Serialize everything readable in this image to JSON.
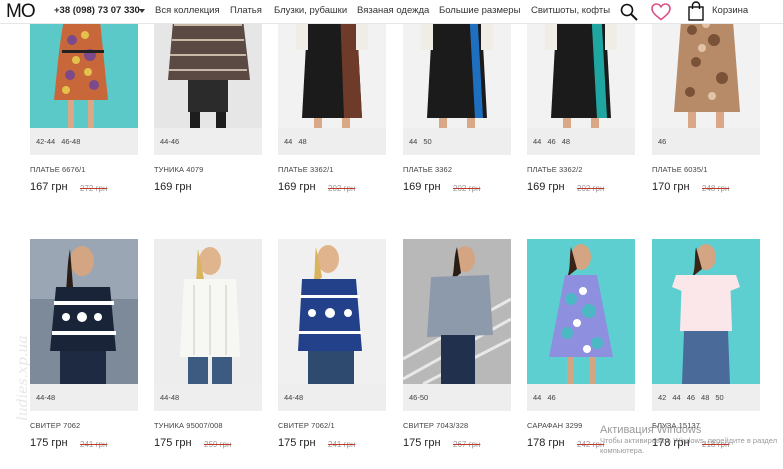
{
  "header": {
    "logo": "MO",
    "phone": "+38 (098) 73 07 330",
    "nav": [
      "Вся коллекция",
      "Платья",
      "Блузки, рубашки",
      "Вязаная одежда",
      "Большие размеры",
      "Свитшоты, кофты"
    ],
    "cart_label": "Корзина",
    "icons": {
      "search": "search-icon",
      "wishlist": "heart-icon",
      "cart": "shopping-bag-icon"
    },
    "colors": {
      "heart": "#d94f86"
    }
  },
  "products": [
    {
      "sizes": [
        "42-44",
        "46-48"
      ],
      "name": "ПЛАТЬЕ 6676/1",
      "price": "167 грн",
      "old_price": "272 грн"
    },
    {
      "sizes": [
        "44-46"
      ],
      "name": "ТУНИКА 4079",
      "price": "169 грн",
      "old_price": ""
    },
    {
      "sizes": [
        "44",
        "48"
      ],
      "name": "ПЛАТЬЕ 3362/1",
      "price": "169 грн",
      "old_price": "202 грн"
    },
    {
      "sizes": [
        "44",
        "50"
      ],
      "name": "ПЛАТЬЕ 3362",
      "price": "169 грн",
      "old_price": "202 грн"
    },
    {
      "sizes": [
        "44",
        "46",
        "48"
      ],
      "name": "ПЛАТЬЕ 3362/2",
      "price": "169 грн",
      "old_price": "202 грн"
    },
    {
      "sizes": [
        "46"
      ],
      "name": "ПЛАТЬЕ 6035/1",
      "price": "170 грн",
      "old_price": "248 грн"
    },
    {
      "sizes": [
        "44-48"
      ],
      "name": "СВИТЕР 7062",
      "price": "175 грн",
      "old_price": "241 грн"
    },
    {
      "sizes": [
        "44-48"
      ],
      "name": "ТУНИКА 95007/008",
      "price": "175 грн",
      "old_price": "259 грн"
    },
    {
      "sizes": [
        "44-48"
      ],
      "name": "СВИТЕР 7062/1",
      "price": "175 грн",
      "old_price": "241 грн"
    },
    {
      "sizes": [
        "46-50"
      ],
      "name": "СВИТЕР 7043/328",
      "price": "175 грн",
      "old_price": "267 грн"
    },
    {
      "sizes": [
        "44",
        "46"
      ],
      "name": "САРАФАН 3299",
      "price": "178 грн",
      "old_price": "242 грн"
    },
    {
      "sizes": [
        "42",
        "44",
        "46",
        "48",
        "50"
      ],
      "name": "БЛУЗА 15137",
      "price": "178 грн",
      "old_price": "218 грн"
    }
  ],
  "overlay": {
    "watermark": "ludies.xp.ua",
    "windows_title": "Активация Windows",
    "windows_line1": "Чтобы активировать Windows, перейдите в раздел",
    "windows_line2": "компьютера."
  }
}
